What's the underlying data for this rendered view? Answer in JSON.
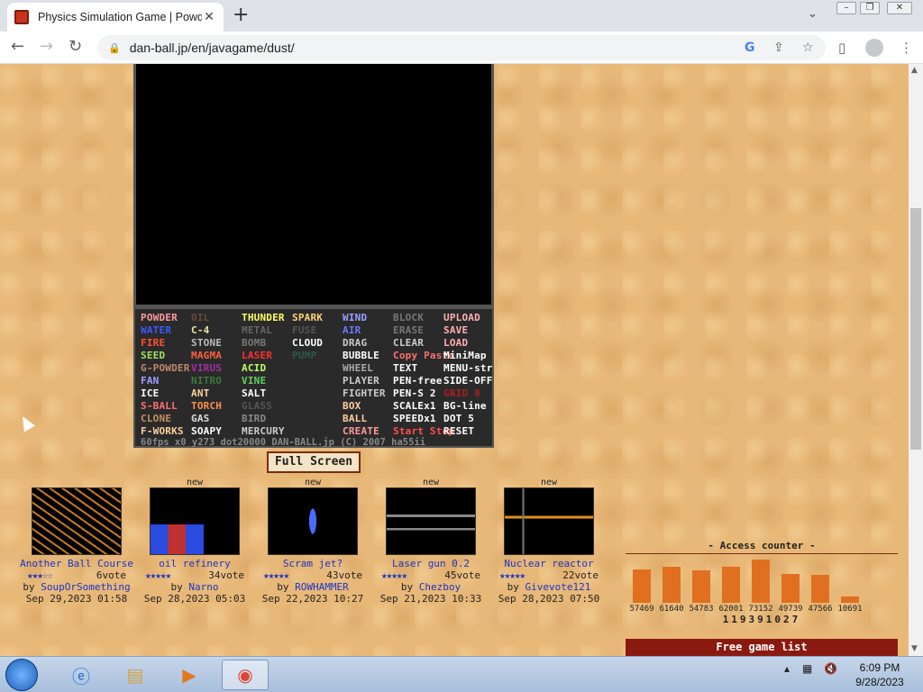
{
  "browser": {
    "tab_title": "Physics Simulation Game | Powde",
    "url": "dan-ball.jp/en/javagame/dust/"
  },
  "game": {
    "menu": [
      {
        "label": "POWDER",
        "color": "#ff9a9a"
      },
      {
        "label": "OIL",
        "color": "#6a4a3a"
      },
      {
        "label": "THUNDER",
        "color": "#ffff66"
      },
      {
        "label": "SPARK",
        "color": "#ffd27a"
      },
      {
        "label": "WIND",
        "color": "#9aa0ff"
      },
      {
        "label": "BLOCK",
        "color": "#777777"
      },
      {
        "label": "UPLOAD",
        "color": "#ffb0b0"
      },
      {
        "label": "WATER",
        "color": "#3a5aff"
      },
      {
        "label": "C-4",
        "color": "#e8e8a0"
      },
      {
        "label": "METAL",
        "color": "#666666"
      },
      {
        "label": "FUSE",
        "color": "#555555"
      },
      {
        "label": "AIR",
        "color": "#6a7aff"
      },
      {
        "label": "ERASE",
        "color": "#777777"
      },
      {
        "label": "SAVE",
        "color": "#ffb0b0"
      },
      {
        "label": "FIRE",
        "color": "#ff5030"
      },
      {
        "label": "STONE",
        "color": "#bbbbbb"
      },
      {
        "label": "BOMB",
        "color": "#777777"
      },
      {
        "label": "CLOUD",
        "color": "#ffffff"
      },
      {
        "label": "DRAG",
        "color": "#cccccc"
      },
      {
        "label": "CLEAR",
        "color": "#cccccc"
      },
      {
        "label": "LOAD",
        "color": "#ffb0b0"
      },
      {
        "label": "SEED",
        "color": "#a0e060"
      },
      {
        "label": "MAGMA",
        "color": "#ff6040"
      },
      {
        "label": "LASER",
        "color": "#ff3030"
      },
      {
        "label": "PUMP",
        "color": "#2a5a4a"
      },
      {
        "label": "BUBBLE",
        "color": "#ffffff"
      },
      {
        "label": "Copy Paste",
        "color": "#ff7070"
      },
      {
        "label": "MiniMap",
        "color": "#ffffff"
      },
      {
        "label": "G-POWDER",
        "color": "#c08a6a"
      },
      {
        "label": "VIRUS",
        "color": "#a030a0"
      },
      {
        "label": "ACID",
        "color": "#c0ff60"
      },
      {
        "label": "WHEEL",
        "color": "#aaaaaa"
      },
      {
        "label": "TEXT",
        "color": "#ffffff"
      },
      {
        "label": "MENU-str",
        "color": "#ffffff"
      },
      {
        "label": "FAN",
        "color": "#9aa0ff"
      },
      {
        "label": "NITRO",
        "color": "#3a7a3a"
      },
      {
        "label": "VINE",
        "color": "#60d060"
      },
      {
        "label": "PLAYER",
        "color": "#cccccc"
      },
      {
        "label": "PEN-free",
        "color": "#ffffff"
      },
      {
        "label": "SIDE-OFF",
        "color": "#ffffff"
      },
      {
        "label": "ICE",
        "color": "#ffffff"
      },
      {
        "label": "ANT",
        "color": "#ffd0a0"
      },
      {
        "label": "SALT",
        "color": "#ffffff"
      },
      {
        "label": "FIGHTER",
        "color": "#cccccc"
      },
      {
        "label": "PEN-S 2",
        "color": "#ffffff"
      },
      {
        "label": "GRID 8",
        "color": "#aa2020"
      },
      {
        "label": "S-BALL",
        "color": "#ff7070"
      },
      {
        "label": "TORCH",
        "color": "#ff9050"
      },
      {
        "label": "GLASS",
        "color": "#555555"
      },
      {
        "label": "BOX",
        "color": "#ffd0a0"
      },
      {
        "label": "SCALEx1",
        "color": "#ffffff"
      },
      {
        "label": "BG-line",
        "color": "#ffffff"
      },
      {
        "label": "CLONE",
        "color": "#c09060"
      },
      {
        "label": "GAS",
        "color": "#dddddd"
      },
      {
        "label": "BIRD",
        "color": "#888888"
      },
      {
        "label": "BALL",
        "color": "#ffd0a0"
      },
      {
        "label": "SPEEDx1",
        "color": "#ffffff"
      },
      {
        "label": "DOT 5",
        "color": "#ffffff"
      },
      {
        "label": "F-WORKS",
        "color": "#ffd0a0"
      },
      {
        "label": "SOAPY",
        "color": "#ffffff"
      },
      {
        "label": "MERCURY",
        "color": "#cccccc"
      },
      {
        "label": "CREATE",
        "color": "#ff9a9a"
      },
      {
        "label": "Start Stop",
        "color": "#ff5050"
      },
      {
        "label": "RESET",
        "color": "#ffffff"
      }
    ],
    "status_line": "60fps x0 y273 dot20000 DAN-BALL.jp (C) 2007 ha55ii",
    "fullscreen_label": "Full Screen"
  },
  "cards": [
    {
      "new": "",
      "title": "Another Ball Course",
      "stars": "★★★☆☆",
      "votes": "6vote",
      "by_prefix": "by ",
      "author": "SoupOrSomething",
      "date": "Sep 29,2023 01:58"
    },
    {
      "new": "new",
      "title": "oil refinery",
      "stars": "★★★★★",
      "votes": "34vote",
      "by_prefix": "by ",
      "author": "Narno",
      "date": "Sep 28,2023 05:03"
    },
    {
      "new": "new",
      "title": "Scram jet?",
      "stars": "★★★★★",
      "votes": "43vote",
      "by_prefix": "by ",
      "author": "ROWHAMMER",
      "date": "Sep 22,2023 10:27"
    },
    {
      "new": "new",
      "title": "Laser gun 0.2",
      "stars": "★★★★★",
      "votes": "45vote",
      "by_prefix": "by ",
      "author": "Chezboy",
      "date": "Sep 21,2023 10:33"
    },
    {
      "new": "new",
      "title": "Nuclear reactor",
      "stars": "★★★★★",
      "votes": "22vote",
      "by_prefix": "by ",
      "author": "Givevote121",
      "date": "Sep 28,2023 07:50"
    }
  ],
  "access_counter": {
    "title": "- Access counter -",
    "values": [
      57469,
      61640,
      54783,
      62001,
      73152,
      49739,
      47566,
      10691
    ],
    "labels": [
      "57469",
      "61640",
      "54783",
      "62001",
      "73152",
      "49739",
      "47566",
      "10691"
    ],
    "total": "119391027"
  },
  "free_game_list": "Free game list",
  "taskbar": {
    "time": "6:09 PM",
    "date": "9/28/2023"
  },
  "colors": {
    "accent_link": "#1a35c8",
    "bar": "#e07020",
    "header_bar": "#8a1a10"
  }
}
